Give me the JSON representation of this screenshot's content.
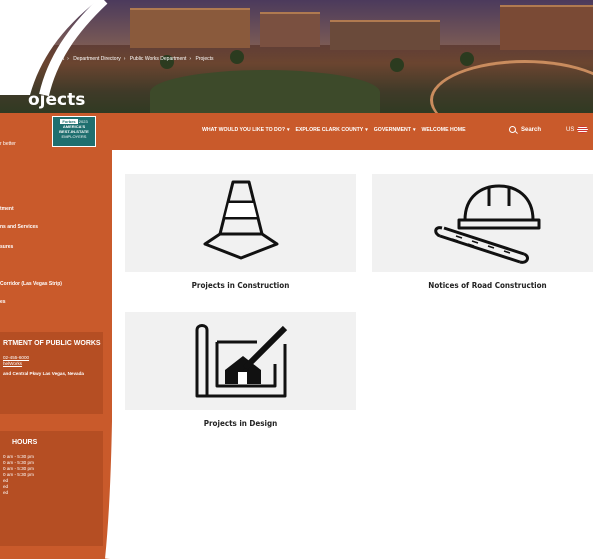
{
  "breadcrumb": [
    "nt",
    "Department Directory",
    "Public Works Department",
    "Projects"
  ],
  "hero_title": "ojects",
  "logo_tagline": "r better",
  "badge": {
    "line1": "Forbes",
    "line2": "2023",
    "line3": "AMERICA'S",
    "line4": "BEST-IN-STATE",
    "line5": "EMPLOYERS"
  },
  "nav": {
    "items": [
      "WHAT WOULD YOU LIKE TO DO?",
      "EXPLORE CLARK COUNTY",
      "GOVERNMENT",
      "WELCOME HOME"
    ],
    "search_label": "Search",
    "lang": "US"
  },
  "sidebar": {
    "items": [
      "tment",
      "ns and Services",
      "sures",
      "Corridor (Las Vegas Strip)",
      "es"
    ],
    "dept_box": {
      "title": "RTMENT OF PUBLIC WORKS",
      "phone": "02-455-6000",
      "social": "helWorks",
      "address": "and Central Pkwy Las Vegas, Nevada"
    },
    "hours_box": {
      "title": "HOURS",
      "lines": [
        "0 am - 5:30 pm",
        "0 am - 5:30 pm",
        "0 am - 5:30 pm",
        "0 am - 5:30 pm",
        "ed",
        "ed",
        "ed"
      ]
    }
  },
  "cards": [
    {
      "label": "Projects in Construction",
      "icon": "traffic-cone-icon"
    },
    {
      "label": "Notices of Road Construction",
      "icon": "hard-hat-blueprint-icon"
    },
    {
      "label": "Projects in Design",
      "icon": "house-design-pencil-icon"
    }
  ],
  "colors": {
    "brand": "#c95a2b",
    "sidebar_box": "#b54e23",
    "card_bg": "#f1f1f1"
  }
}
